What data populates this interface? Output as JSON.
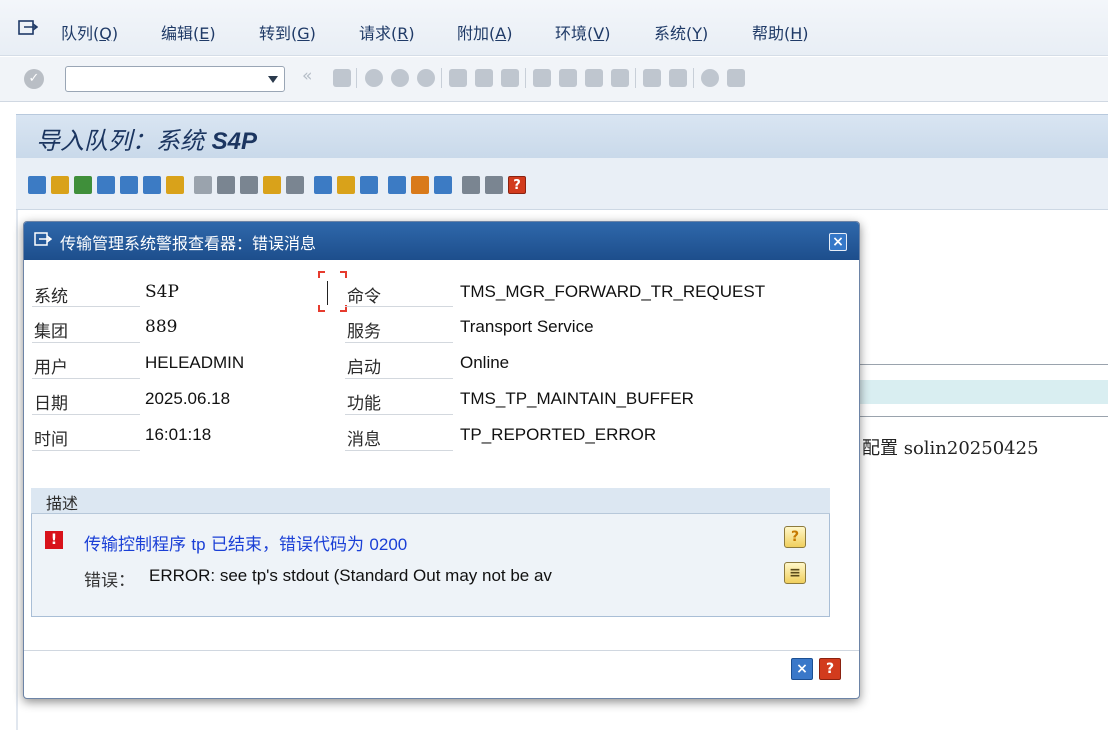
{
  "menu": {
    "items": [
      {
        "label": "队列(",
        "hotkey": "Q",
        "suffix": ")"
      },
      {
        "label": "编辑(",
        "hotkey": "E",
        "suffix": ")"
      },
      {
        "label": "转到(",
        "hotkey": "G",
        "suffix": ")"
      },
      {
        "label": "请求(",
        "hotkey": "R",
        "suffix": ")"
      },
      {
        "label": "附加(",
        "hotkey": "A",
        "suffix": ")"
      },
      {
        "label": "环境(",
        "hotkey": "V",
        "suffix": ")"
      },
      {
        "label": "系统(",
        "hotkey": "Y",
        "suffix": ")"
      },
      {
        "label": "帮助(",
        "hotkey": "H",
        "suffix": ")"
      }
    ]
  },
  "toolbar": {
    "command_value": "",
    "check_icon": "check-circle-icon",
    "overflow": "«"
  },
  "title": {
    "prefix": "导入队列：系统 ",
    "system": "S4P"
  },
  "background": {
    "config_text": "配置 solin20250425"
  },
  "dialog": {
    "title": "传输管理系统警报查看器：错误消息",
    "close_glyph": "×",
    "fields_left": [
      {
        "label": "系统",
        "value": "S4P"
      },
      {
        "label": "集团",
        "value": "889"
      },
      {
        "label": "用户",
        "value": "HELEADMIN"
      },
      {
        "label": "日期",
        "value": "2025.06.18"
      },
      {
        "label": "时间",
        "value": "16:01:18"
      }
    ],
    "fields_right": [
      {
        "label": "命令",
        "value": "TMS_MGR_FORWARD_TR_REQUEST"
      },
      {
        "label": "服务",
        "value": "Transport Service"
      },
      {
        "label": "启动",
        "value": "Online"
      },
      {
        "label": "功能",
        "value": "TMS_TP_MAINTAIN_BUFFER"
      },
      {
        "label": "消息",
        "value": "TP_REPORTED_ERROR"
      }
    ],
    "description": {
      "header": "描述",
      "error_glyph": "!",
      "message_part1": "传输控制程序 ",
      "message_code": "tp",
      "message_part2": " 已结束，错误代码为 ",
      "message_errcode": "0200",
      "detail_label": "错误：",
      "detail_text": "ERROR: see tp's stdout (Standard Out may not be av",
      "help_glyph": "?",
      "longtext_glyph": "≡"
    },
    "footer": {
      "cancel_glyph": "×",
      "help_glyph": "?"
    }
  },
  "colors": {
    "dialog_title_bg": "#1d4e8c",
    "message_blue": "#1a3fd6",
    "error_red": "#d8121b"
  }
}
